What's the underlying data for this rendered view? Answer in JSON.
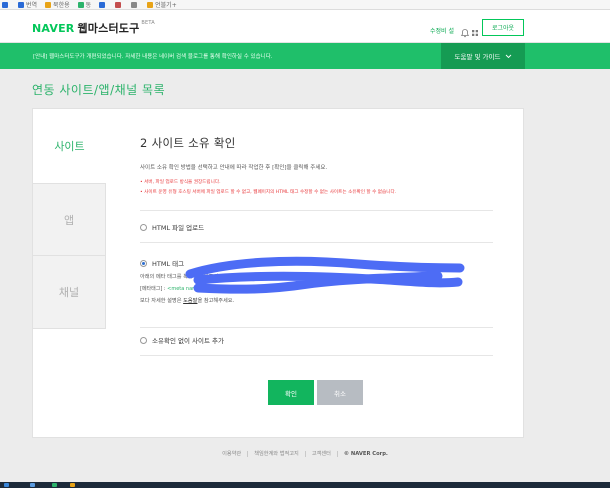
{
  "bookmarks": [
    {
      "label": "",
      "color": "#2a6ad6"
    },
    {
      "label": "번역",
      "color": "#2a6ad6"
    },
    {
      "label": "북한용",
      "color": "#e8a317"
    },
    {
      "label": "동",
      "color": "#2cb36b"
    },
    {
      "label": "",
      "color": "#2a6ad6"
    },
    {
      "label": "",
      "color": "#c34d4d"
    },
    {
      "label": "",
      "color": "#888888"
    },
    {
      "label": "언블기+",
      "color": "#e8a317"
    }
  ],
  "header": {
    "logo_brand": "NAVER",
    "logo_service": "웹마스터도구",
    "logo_badge": "BETA",
    "user_link": "수정비 설",
    "logout": "로그아웃"
  },
  "notice": {
    "text": "[안내] 웹마스터도구가 개편되었습니다. 자세한 내용은 네이버 검색 블로그를 통해 확인하실 수 있습니다.",
    "guide_button": "도움말 및 가이드"
  },
  "page_title": "연동 사이트/앱/채널 목록",
  "tabs": [
    {
      "label": "사이트"
    },
    {
      "label": "앱"
    },
    {
      "label": "채널"
    }
  ],
  "step_title": "2 사이트 소유 확인",
  "instruction": "사이트 소유 확인 방법을 선택하고 안내에 따라 작업한 후 [확인]을 클릭해 주세요.",
  "warnings": [
    "• 서버, 파일 업로드 방식을 권장드립니다.",
    "• 사이트 운영 유형 호스팅 서버에 파일 업로드 할 수 없고, 웹페이지의 HTML 태그 수정할 수 없는 사이트는 소유확인 할 수 없습니다."
  ],
  "options": {
    "file_upload": "HTML 파일 업로드",
    "html_tag": "HTML 태그",
    "no_verify": "소유확인 없이 사이트 추가"
  },
  "html_tag_desc": "아래의 메타 태그를 복사해 사이트 홈페이지의 <head>영역에 붙여 넣어주세요.",
  "meta_label": "[메타태그] :",
  "meta_code": "<meta name=",
  "ref_prefix": "보다 자세한 설명은",
  "ref_link": "도움말",
  "ref_suffix": "을 참고해주세요.",
  "buttons": {
    "confirm": "확인",
    "cancel": "취소"
  },
  "footer": {
    "terms": "이용약관",
    "privacy": "책임한계와 법적고지",
    "support": "고객센터",
    "corp": "© NAVER Corp."
  },
  "colors": {
    "brand_green": "#03c75a",
    "notice_green": "#1fbf6a",
    "radio_blue": "#2f6fd0",
    "redaction_blue": "#4d6cf5"
  }
}
